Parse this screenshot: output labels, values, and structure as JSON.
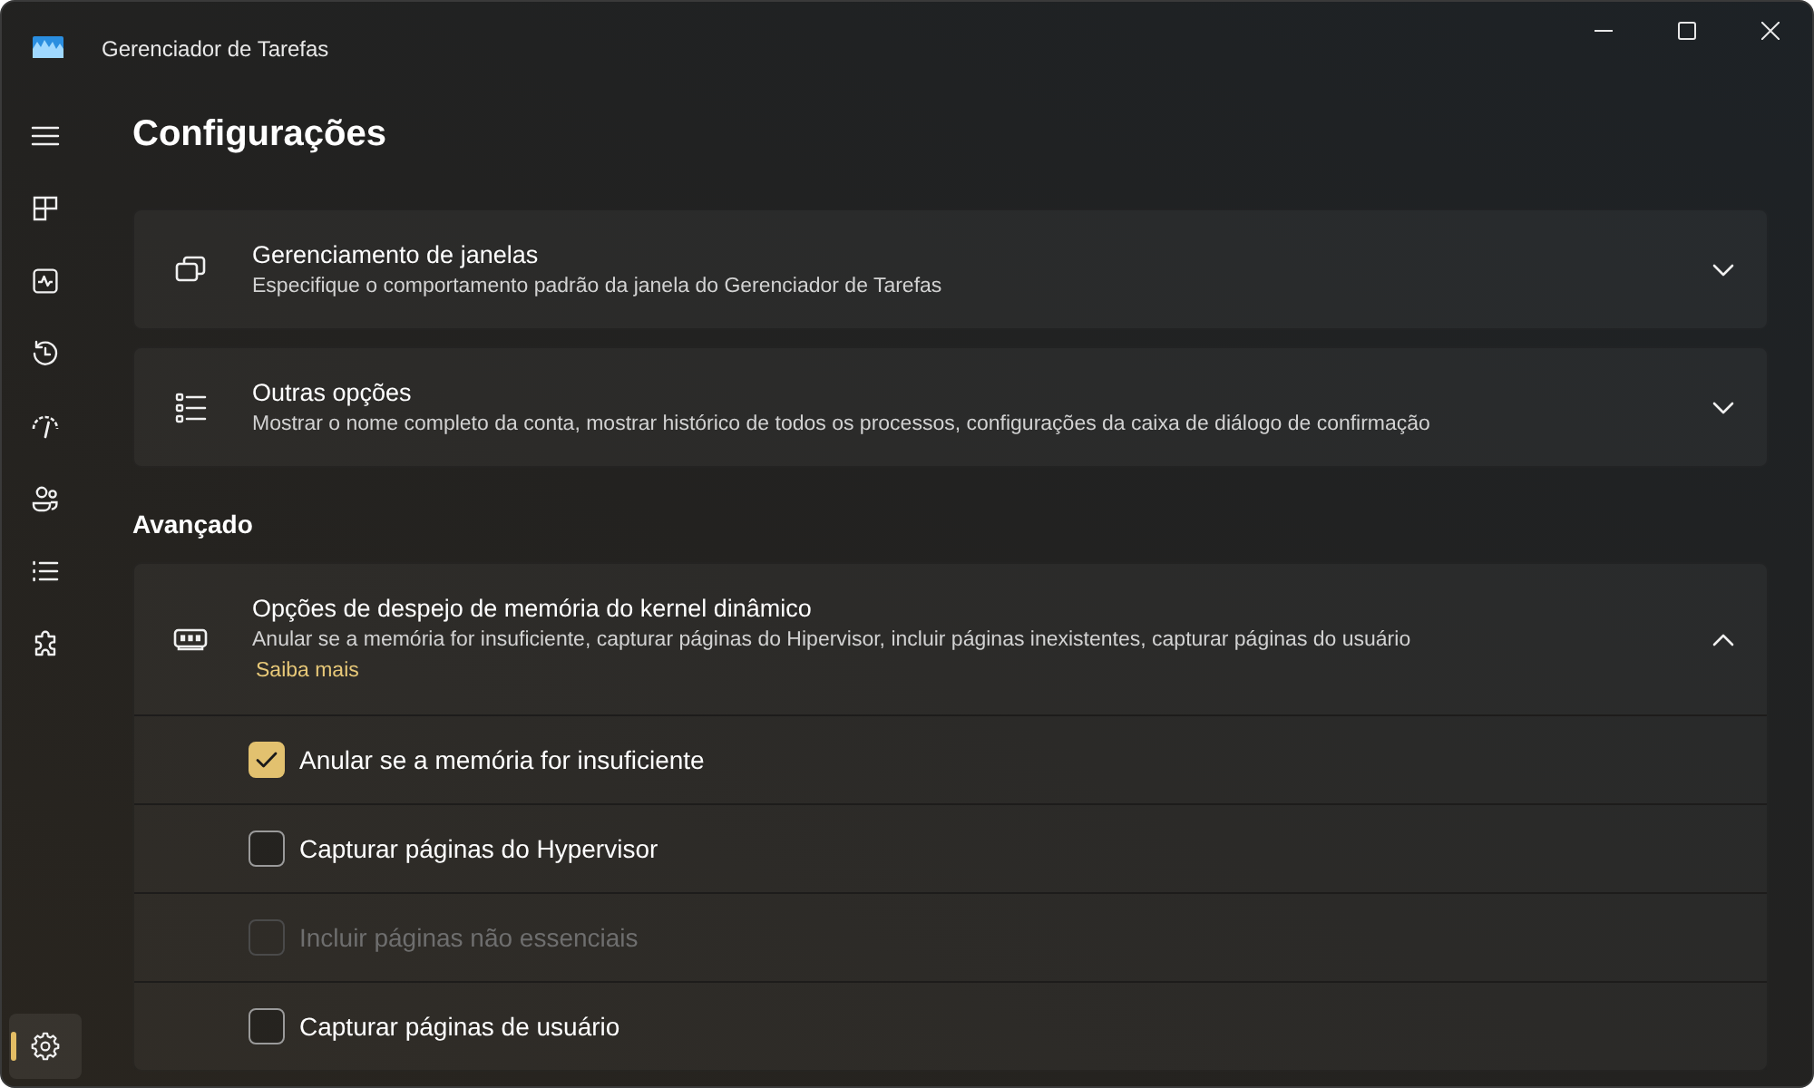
{
  "window": {
    "title": "Gerenciador de Tarefas"
  },
  "sidebar": {
    "items": [
      {
        "selected": false
      },
      {
        "selected": false
      },
      {
        "selected": false
      },
      {
        "selected": false
      },
      {
        "selected": false
      },
      {
        "selected": false
      },
      {
        "selected": false
      }
    ],
    "footer_items": [
      {
        "selected": true
      }
    ]
  },
  "page_title": "Configurações",
  "cards": [
    {
      "title": "Gerenciamento de janelas",
      "subtitle": "Especifique o comportamento padrão da janela do Gerenciador de Tarefas",
      "expanded": false
    },
    {
      "title": "Outras opções",
      "subtitle": "Mostrar o nome completo da conta, mostrar histórico de todos os processos, configurações da caixa de diálogo de confirmação",
      "expanded": false
    }
  ],
  "advanced": {
    "heading": "Avançado",
    "cards": [
      {
        "title": "Opções de despejo de memória do kernel dinâmico",
        "subtitle": "Anular se a memória for insuficiente, capturar páginas do Hipervisor, incluir páginas inexistentes, capturar páginas do usuário",
        "link": "Saiba mais",
        "expanded": true,
        "options": [
          {
            "label": "Anular se a memória for insuficiente",
            "checked": true,
            "disabled": false
          },
          {
            "label": "Capturar páginas do Hypervisor",
            "checked": false,
            "disabled": false
          },
          {
            "label": "Incluir páginas não essenciais",
            "checked": false,
            "disabled": true
          },
          {
            "label": "Capturar páginas de usuário",
            "checked": false,
            "disabled": false
          }
        ]
      }
    ]
  }
}
